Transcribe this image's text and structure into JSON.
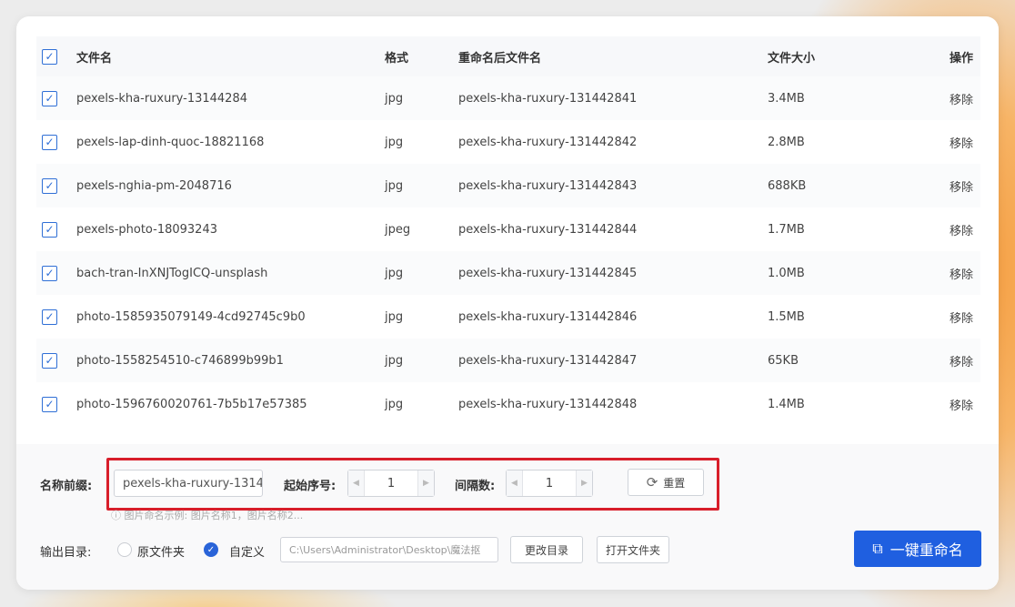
{
  "table": {
    "headers": {
      "name": "文件名",
      "format": "格式",
      "renamed": "重命名后文件名",
      "size": "文件大小",
      "action": "操作"
    },
    "rows": [
      {
        "name": "pexels-kha-ruxury-13144284",
        "format": "jpg",
        "renamed": "pexels-kha-ruxury-131442841",
        "size": "3.4MB",
        "action": "移除"
      },
      {
        "name": "pexels-lap-dinh-quoc-18821168",
        "format": "jpg",
        "renamed": "pexels-kha-ruxury-131442842",
        "size": "2.8MB",
        "action": "移除"
      },
      {
        "name": "pexels-nghia-pm-2048716",
        "format": "jpg",
        "renamed": "pexels-kha-ruxury-131442843",
        "size": "688KB",
        "action": "移除"
      },
      {
        "name": "pexels-photo-18093243",
        "format": "jpeg",
        "renamed": "pexels-kha-ruxury-131442844",
        "size": "1.7MB",
        "action": "移除"
      },
      {
        "name": "bach-tran-InXNJTogICQ-unsplash",
        "format": "jpg",
        "renamed": "pexels-kha-ruxury-131442845",
        "size": "1.0MB",
        "action": "移除"
      },
      {
        "name": "photo-1585935079149-4cd92745c9b0",
        "format": "jpg",
        "renamed": "pexels-kha-ruxury-131442846",
        "size": "1.5MB",
        "action": "移除"
      },
      {
        "name": "photo-1558254510-c746899b99b1",
        "format": "jpg",
        "renamed": "pexels-kha-ruxury-131442847",
        "size": "65KB",
        "action": "移除"
      },
      {
        "name": "photo-1596760020761-7b5b17e57385",
        "format": "jpg",
        "renamed": "pexels-kha-ruxury-131442848",
        "size": "1.4MB",
        "action": "移除"
      }
    ]
  },
  "controls": {
    "prefix_label": "名称前缀:",
    "prefix_value": "pexels-kha-ruxury-1314",
    "start_label": "起始序号:",
    "start_value": "1",
    "interval_label": "间隔数:",
    "interval_value": "1",
    "reset_label": "重置",
    "hint": "图片命名示例: 图片名称1，图片名称2..."
  },
  "output": {
    "label": "输出目录:",
    "option_original": "原文件夹",
    "option_custom": "自定义",
    "selected": "自定义",
    "path": "C:\\Users\\Administrator\\Desktop\\魔法抠",
    "change_dir": "更改目录",
    "open_folder": "打开文件夹"
  },
  "primary_action": {
    "label": "一键重命名",
    "color": "#1f5fe0"
  },
  "accent_colors": {
    "highlight_box": "#d81e2a",
    "checkbox": "#2f6fd6"
  },
  "icons": {
    "checkbox": "check-icon",
    "reset": "refresh-icon",
    "rename": "external-link-icon",
    "hint": "info-icon"
  }
}
